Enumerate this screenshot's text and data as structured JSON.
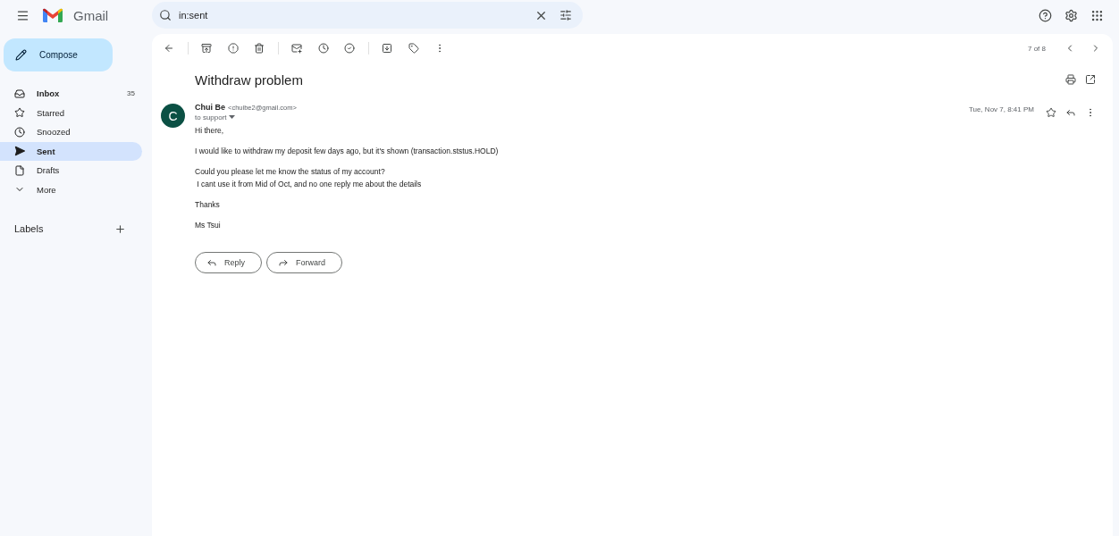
{
  "app": {
    "name": "Gmail"
  },
  "search": {
    "value": "in:sent"
  },
  "compose": {
    "label": "Compose"
  },
  "nav": [
    {
      "kind": "inbox",
      "label": "Inbox",
      "count": "35",
      "selected": false,
      "unread": true
    },
    {
      "kind": "starred",
      "label": "Starred",
      "selected": false,
      "unread": false
    },
    {
      "kind": "snoozed",
      "label": "Snoozed",
      "selected": false,
      "unread": false
    },
    {
      "kind": "sent",
      "label": "Sent",
      "selected": true,
      "unread": false
    },
    {
      "kind": "drafts",
      "label": "Drafts",
      "selected": false,
      "unread": false
    },
    {
      "kind": "more",
      "label": "More",
      "selected": false,
      "unread": false
    }
  ],
  "labels": {
    "heading": "Labels"
  },
  "pager": {
    "text": "7 of 8"
  },
  "message": {
    "subject": "Withdraw problem",
    "avatar": "C",
    "sender": "Chui Be",
    "email": "<chuibe2@gmail.com>",
    "to": "to support",
    "date": "Tue, Nov 7, 8:41 PM",
    "paragraphs": [
      [
        "Hi there,"
      ],
      [
        "I would like to withdraw my deposit few days ago, but it's shown (transaction.ststus.HOLD)"
      ],
      [
        "Could you please let me know the status of my account?",
        " I cant use it from Mid of Oct, and no one reply me about the details"
      ],
      [
        "Thanks"
      ],
      [
        "Ms Tsui"
      ]
    ]
  },
  "actions": [
    {
      "kind": "reply",
      "label": "Reply"
    },
    {
      "kind": "forward",
      "label": "Forward"
    }
  ]
}
